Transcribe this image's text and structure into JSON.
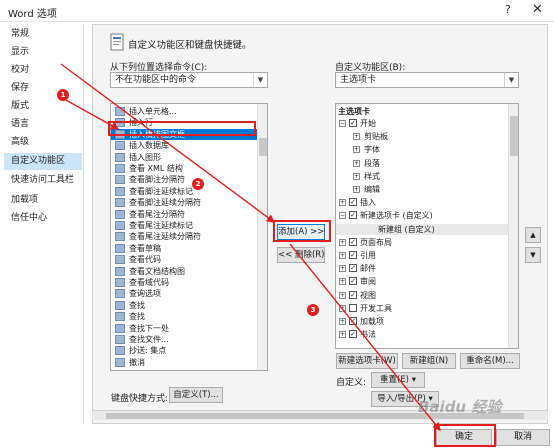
{
  "window": {
    "title": "Word 选项",
    "help_glyph": "?",
    "close_glyph": "✕"
  },
  "sidebar": {
    "items": [
      {
        "label": "常规"
      },
      {
        "label": "显示"
      },
      {
        "label": "校对"
      },
      {
        "label": "保存"
      },
      {
        "label": "版式"
      },
      {
        "label": "语言"
      },
      {
        "label": "高级"
      },
      {
        "label": "自定义功能区"
      },
      {
        "label": "快速访问工具栏"
      },
      {
        "label": "加载项"
      },
      {
        "label": "信任中心"
      }
    ]
  },
  "main": {
    "header": "自定义功能区和键盘快捷键。",
    "left_label": "从下列位置选择命令(C):",
    "left_combo": "不在功能区中的命令",
    "right_label": "自定义功能区(B):",
    "right_combo": "主选项卡",
    "commands": [
      "插入单元格...",
      "插入行",
      "插入横排图文框",
      "插入数据库",
      "插入图形",
      "查看 XML 结构",
      "查看脚注分隔符",
      "查看脚注延续标记",
      "查看脚注延续分隔符",
      "查看尾注分隔符",
      "查看尾注延续标记",
      "查看尾注延续分隔符",
      "查看草稿",
      "查看代码",
      "查看文档结构图",
      "查看域代码",
      "查询选项",
      "查找",
      "查找",
      "查找下一处",
      "查找文件...",
      "抄送: 集点",
      "撤消"
    ],
    "add_button": "添加(A) >>",
    "remove_button": "<< 删除(R)",
    "tree_header": "主选项卡",
    "tree": [
      {
        "label": "开始",
        "level": 0,
        "expand": "⊟",
        "checked": true
      },
      {
        "label": "剪贴板",
        "level": 1,
        "expand": "⊞",
        "checked": null
      },
      {
        "label": "字体",
        "level": 1,
        "expand": "⊞",
        "checked": null
      },
      {
        "label": "段落",
        "level": 1,
        "expand": "⊞",
        "checked": null
      },
      {
        "label": "样式",
        "level": 1,
        "expand": "⊞",
        "checked": null
      },
      {
        "label": "编辑",
        "level": 1,
        "expand": "⊞",
        "checked": null
      },
      {
        "label": "插入",
        "level": 0,
        "expand": "⊞",
        "checked": true
      },
      {
        "label": "新建选项卡 (自定义)",
        "level": 0,
        "expand": "⊟",
        "checked": true
      },
      {
        "label": "新建组 (自定义)",
        "level": 2,
        "expand": "",
        "checked": null
      },
      {
        "label": "页面布局",
        "level": 0,
        "expand": "⊞",
        "checked": true
      },
      {
        "label": "引用",
        "level": 0,
        "expand": "⊞",
        "checked": true
      },
      {
        "label": "邮件",
        "level": 0,
        "expand": "⊞",
        "checked": true
      },
      {
        "label": "审阅",
        "level": 0,
        "expand": "⊞",
        "checked": true
      },
      {
        "label": "视图",
        "level": 0,
        "expand": "⊞",
        "checked": true
      },
      {
        "label": "开发工具",
        "level": 0,
        "expand": "⊞",
        "checked": false
      },
      {
        "label": "加载项",
        "level": 0,
        "expand": "⊞",
        "checked": true
      },
      {
        "label": "书法",
        "level": 0,
        "expand": "⊞",
        "checked": true
      }
    ],
    "new_tab_button": "新建选项卡(W)",
    "new_group_button": "新建组(N)",
    "rename_button": "重命名(M)...",
    "customize_label": "自定义:",
    "reset_button": "重置(E) ▾",
    "import_export_button": "导入/导出(P) ▾",
    "keyboard_label": "键盘快捷方式:",
    "keyboard_button": "自定义(T)...",
    "move_up": "▲",
    "move_down": "▼"
  },
  "footer": {
    "ok": "确定",
    "cancel": "取消"
  },
  "annotations": {
    "marker_1": "1",
    "marker_2": "2",
    "marker_3": "3",
    "color": "#e02020"
  },
  "watermark": "Baidu 经验"
}
